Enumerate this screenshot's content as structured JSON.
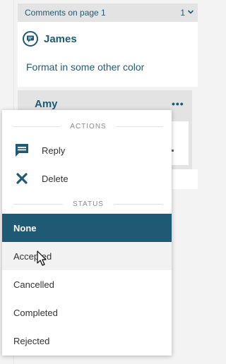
{
  "comments_header": {
    "label": "Comments on page 1",
    "count": "1"
  },
  "comment": {
    "author": "James",
    "text": "Format in some other color"
  },
  "reply": {
    "author": "Amy",
    "menu_glyph": "•••"
  },
  "menu": {
    "actions_label": "ACTIONS",
    "actions": [
      {
        "label": "Reply",
        "icon": "reply-icon"
      },
      {
        "label": "Delete",
        "icon": "delete-x-icon"
      }
    ],
    "status_label": "STATUS",
    "statuses": [
      {
        "label": "None",
        "selected": true
      },
      {
        "label": "Accepted",
        "hovered": true
      },
      {
        "label": "Cancelled"
      },
      {
        "label": "Completed"
      },
      {
        "label": "Rejected"
      }
    ]
  },
  "colors": {
    "accent": "#1f5a74",
    "panel_bg": "#f3f3f3",
    "header_bg": "#e3e3e3",
    "menu_bg": "#ffffff"
  }
}
